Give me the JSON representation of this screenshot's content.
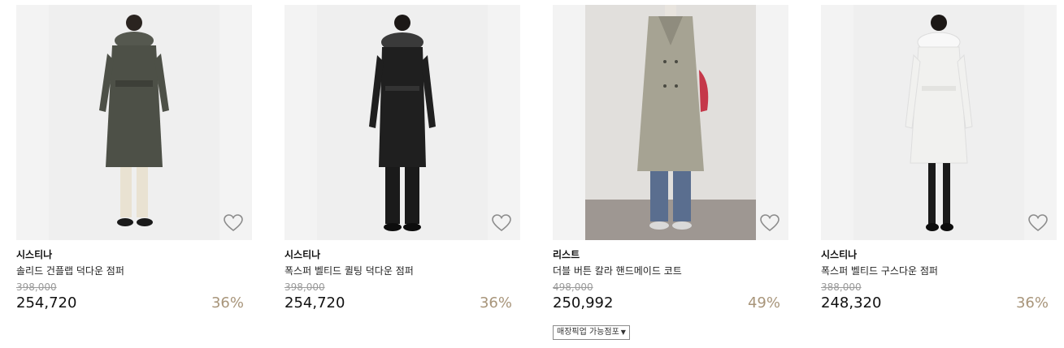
{
  "products": [
    {
      "brand": "시스티나",
      "name": "솔리드 건플랩 덕다운 점퍼",
      "original_price": "398,000",
      "price": "254,720",
      "discount": "36%",
      "coat_color": "#4d5047",
      "trouser_color": "#e9e2d2",
      "backdrop": "studio"
    },
    {
      "brand": "시스티나",
      "name": "폭스퍼 벨티드 퀼팅 덕다운 점퍼",
      "original_price": "398,000",
      "price": "254,720",
      "discount": "36%",
      "coat_color": "#1f1f1f",
      "trouser_color": "#1a1a1a",
      "backdrop": "studio"
    },
    {
      "brand": "리스트",
      "name": "더블 버튼 칼라 핸드메이드 코트",
      "original_price": "498,000",
      "price": "250,992",
      "discount": "49%",
      "pickup_label": "매장픽업 가능점포",
      "coat_color": "#a6a393",
      "trouser_color": "#5a6e8f",
      "backdrop": "room"
    },
    {
      "brand": "시스티나",
      "name": "폭스퍼 벨티드 구스다운 점퍼",
      "original_price": "388,000",
      "price": "248,320",
      "discount": "36%",
      "coat_color": "#f1f1ef",
      "trouser_color": "#1a1a1a",
      "backdrop": "studio"
    }
  ],
  "colors": {
    "discount": "#a8957a",
    "original_price": "#9a9a9a",
    "heart_outline": "#8c8c8c"
  }
}
